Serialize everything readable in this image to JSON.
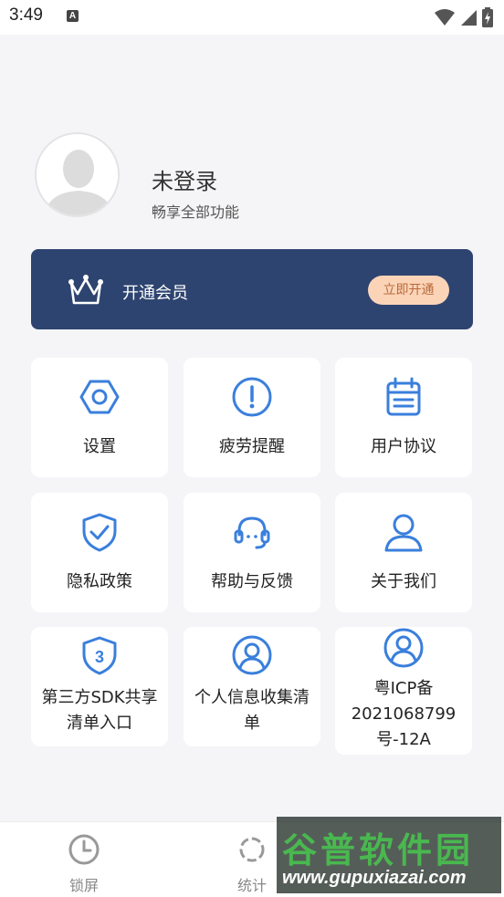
{
  "status_bar": {
    "time": "3:49",
    "notification_letter": "A"
  },
  "profile": {
    "name": "未登录",
    "subtitle": "畅享全部功能"
  },
  "vip": {
    "label": "开通会员",
    "button_label": "立即开通"
  },
  "menu": [
    {
      "label": "设置",
      "icon": "settings-icon"
    },
    {
      "label": "疲劳提醒",
      "icon": "alert-icon"
    },
    {
      "label": "用户协议",
      "icon": "calendar-doc-icon"
    },
    {
      "label": "隐私政策",
      "icon": "shield-check-icon"
    },
    {
      "label": "帮助与反馈",
      "icon": "headset-icon"
    },
    {
      "label": "关于我们",
      "icon": "user-icon"
    },
    {
      "label_line1": "第三方SDK共享",
      "label_line2": "清单入口",
      "icon": "shield-3-icon"
    },
    {
      "label_line1": "个人信息收集清",
      "label_line2": "单",
      "icon": "user-circle-icon"
    },
    {
      "label_line1": "粤ICP备",
      "label_line2": "2021068799",
      "label_line3": "号-12A",
      "icon": "user-circle-icon"
    }
  ],
  "bottom_nav": [
    {
      "label": "锁屏",
      "icon": "clock-icon"
    },
    {
      "label": "统计",
      "icon": "stats-icon"
    }
  ],
  "watermark": {
    "title": "谷普软件园",
    "url": "www.gupuxiazai.com"
  },
  "colors": {
    "accent": "#3a7fdc",
    "vip_bg": "#2e4470",
    "vip_button": "#fbd4b8"
  }
}
